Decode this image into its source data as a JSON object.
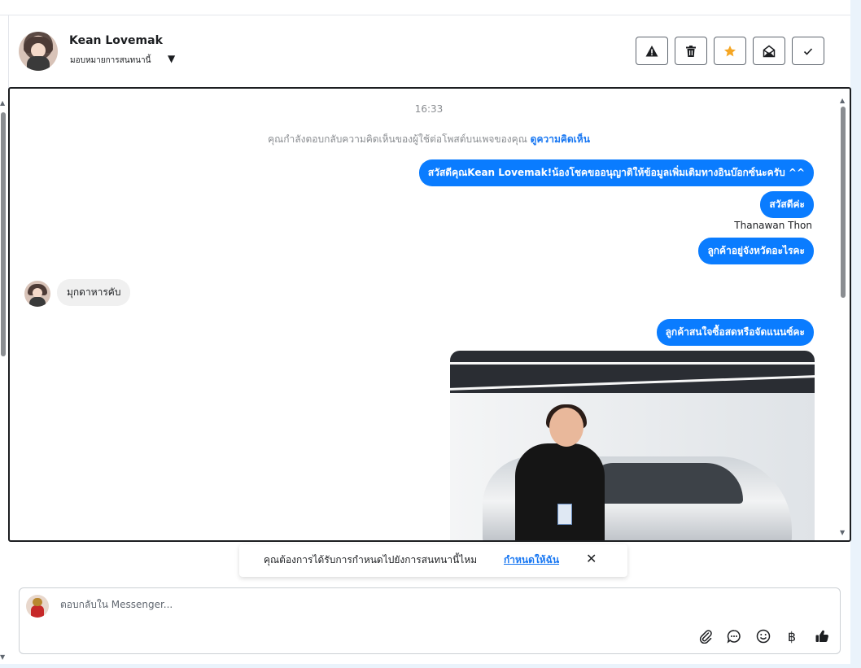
{
  "header": {
    "contact_name": "Kean Lovemak",
    "assign_label": "มอบหมายการสนทนานี้",
    "toolbar": {
      "spam_icon": "warning-icon",
      "delete_icon": "trash-icon",
      "star_icon": "star-icon",
      "unread_icon": "envelope-open-icon",
      "done_icon": "check-icon",
      "star_color": "#f5a623"
    }
  },
  "conversation": {
    "timestamp": "16:33",
    "notice_text": "คุณกำลังตอบกลับความคิดเห็นของผู้ใช้ต่อโพสต์บนเพจของคุณ",
    "notice_link": "ดูความคิดเห็น",
    "messages": [
      {
        "direction": "out",
        "text": "สวัสดีคุณKean Lovemak!น้องโชคขออนุญาติให้ข้อมูลเพิ่มเติมทางอินบ๊อกซ์นะครับ ^^"
      },
      {
        "direction": "out",
        "text": "สวัสดีค่ะ"
      },
      {
        "direction": "out",
        "sender": "Thanawan Thon",
        "text": "ลูกค้าอยู่จังหวัดอะไรคะ"
      },
      {
        "direction": "in",
        "text": "มุกดาหารคับ"
      },
      {
        "direction": "out",
        "text": "ลูกค้าสนใจซื้อสดหรือจัดแนนซ์คะ"
      }
    ],
    "out_bubble_color": "#0a7cff"
  },
  "toast": {
    "text": "คุณต้องการได้รับการกำหนดไปยังการสนทนานี้ไหม",
    "link": "กำหนดให้ฉัน"
  },
  "composer": {
    "placeholder": "ตอบกลับใน Messenger...",
    "tools": [
      "paperclip-icon",
      "chat-bubble-icon",
      "emoji-icon",
      "baht-icon",
      "thumbs-up-icon"
    ]
  }
}
